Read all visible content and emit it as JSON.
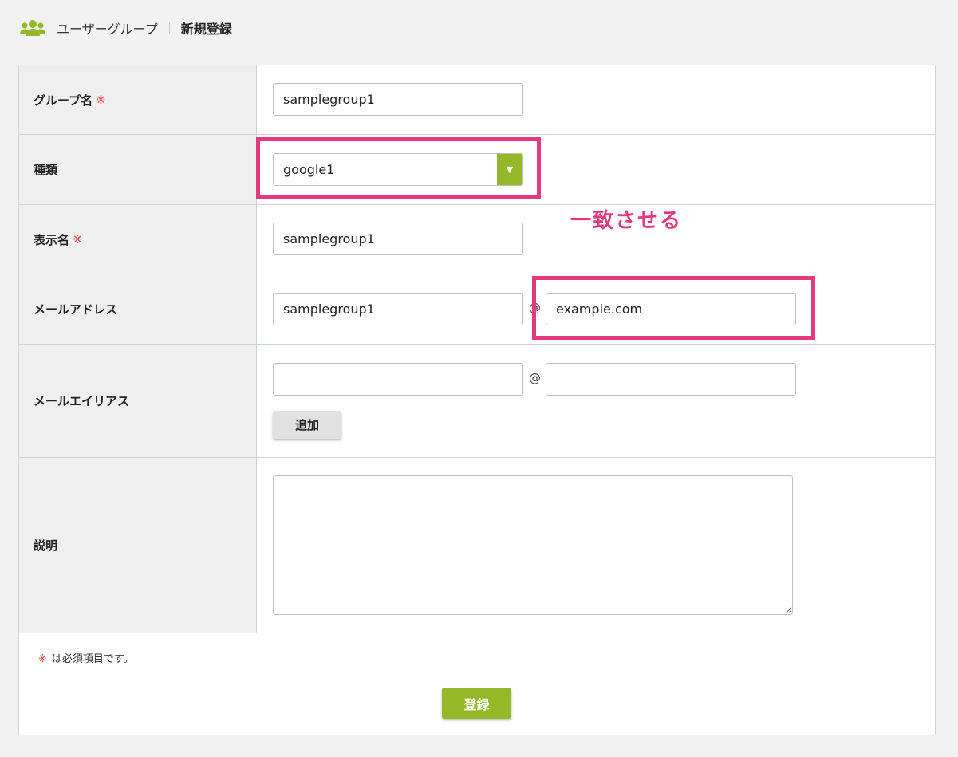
{
  "breadcrumb": {
    "section": "ユーザーグループ",
    "current": "新規登録"
  },
  "form": {
    "required_mark": "※",
    "group_name": {
      "label": "グループ名",
      "value": "samplegroup1"
    },
    "type": {
      "label": "種類",
      "selected": "google1"
    },
    "display_name": {
      "label": "表示名",
      "value": "samplegroup1"
    },
    "email": {
      "label": "メールアドレス",
      "local": "samplegroup1",
      "at": "@",
      "domain": "example.com"
    },
    "alias": {
      "label": "メールエイリアス",
      "local": "",
      "at": "@",
      "domain": "",
      "add_button": "追加"
    },
    "description": {
      "label": "説明",
      "value": ""
    },
    "note": {
      "mark": "※",
      "text": "は必須項目です。"
    },
    "submit_label": "登録"
  },
  "annotation": {
    "text": "一致させる",
    "color": "#e4387f"
  },
  "colors": {
    "accent": "#95b82a",
    "required": "#e23c3c",
    "highlight": "#e4387f"
  },
  "icons": {
    "header": "users-icon",
    "select_arrow": "triangle-down-icon"
  }
}
